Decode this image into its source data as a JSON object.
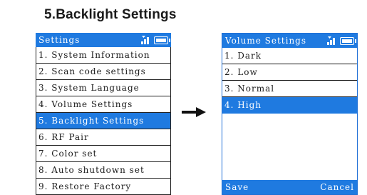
{
  "heading": "5.Backlight Settings",
  "colors": {
    "accent": "#1f7ae0",
    "text": "#1a1a1a",
    "background": "#ffffff"
  },
  "left_screen": {
    "title": "Settings",
    "status_icons": [
      "signal-icon",
      "battery-icon"
    ],
    "items": [
      {
        "label": "1. System Information"
      },
      {
        "label": "2. Scan code settings"
      },
      {
        "label": "3. System Language"
      },
      {
        "label": "4. Volume Settings"
      },
      {
        "label": "5. Backlight Settings",
        "selected": true
      },
      {
        "label": "6. RF Pair"
      },
      {
        "label": "7. Color set"
      },
      {
        "label": "8. Auto shutdown set"
      },
      {
        "label": "9. Restore Factory"
      }
    ]
  },
  "transition_icon": "right-arrow-icon",
  "right_screen": {
    "title": "Volume Settings",
    "status_icons": [
      "signal-icon",
      "battery-icon"
    ],
    "items": [
      {
        "label": "1. Dark"
      },
      {
        "label": "2. Low"
      },
      {
        "label": "3. Normal"
      },
      {
        "label": "4. High",
        "selected": true
      }
    ],
    "softkeys": {
      "left": "Save",
      "right": "Cancel"
    }
  }
}
